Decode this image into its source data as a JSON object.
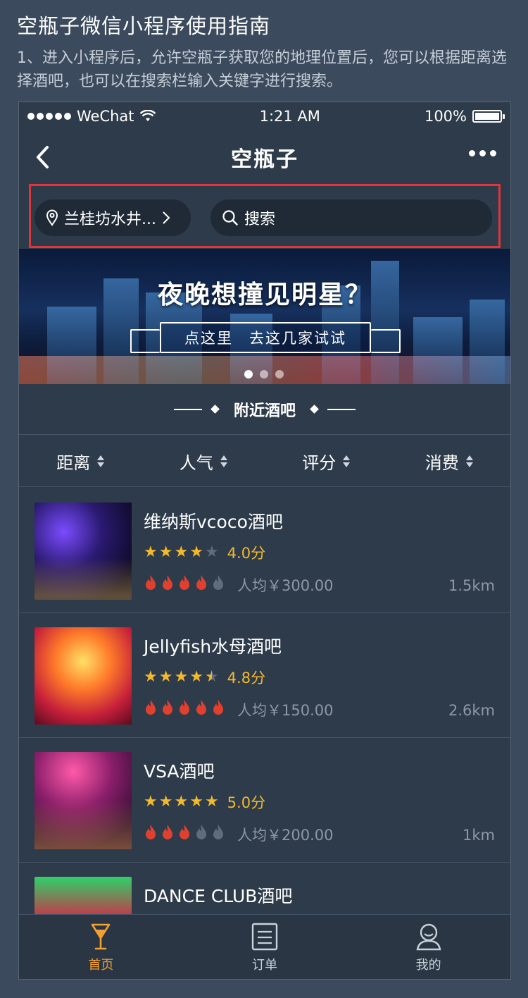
{
  "guide": {
    "title": "空瓶子微信小程序使用指南",
    "description": "1、进入小程序后，允许空瓶子获取您的地理位置后，您可以根据距离选择酒吧，也可以在搜索栏输入关键字进行搜索。"
  },
  "status_bar": {
    "carrier": "WeChat",
    "time": "1:21 AM",
    "battery": "100%"
  },
  "navbar": {
    "title": "空瓶子"
  },
  "location": {
    "label": "兰桂坊水井..."
  },
  "search": {
    "label": "搜索"
  },
  "banner": {
    "headline": "夜晚想撞见明星？",
    "cta": "点这里　去这几家试试",
    "slides": 3,
    "active_slide": 1
  },
  "section": {
    "title": "附近酒吧"
  },
  "sort_tabs": [
    "距离",
    "人气",
    "评分",
    "消费"
  ],
  "bars": [
    {
      "name": "维纳斯vcoco酒吧",
      "rating": 4.0,
      "score_label": "4.0分",
      "price_level": 4,
      "price": "人均￥300.00",
      "distance": "1.5km"
    },
    {
      "name": "Jellyfish水母酒吧",
      "rating": 4.5,
      "score_label": "4.8分",
      "price_level": 5,
      "price": "人均￥150.00",
      "distance": "2.6km"
    },
    {
      "name": "VSA酒吧",
      "rating": 5.0,
      "score_label": "5.0分",
      "price_level": 3,
      "price": "人均￥200.00",
      "distance": "1km"
    },
    {
      "name": "DANCE CLUB酒吧"
    }
  ],
  "tabbar": {
    "items": [
      {
        "label": "首页",
        "icon": "cocktail-glass-icon"
      },
      {
        "label": "订单",
        "icon": "order-list-icon"
      },
      {
        "label": "我的",
        "icon": "user-icon"
      }
    ],
    "active": 0
  },
  "colors": {
    "accent": "#f2a031",
    "star": "#f3b92e",
    "flame": "#e0402e",
    "highlight": "#e0353b"
  }
}
